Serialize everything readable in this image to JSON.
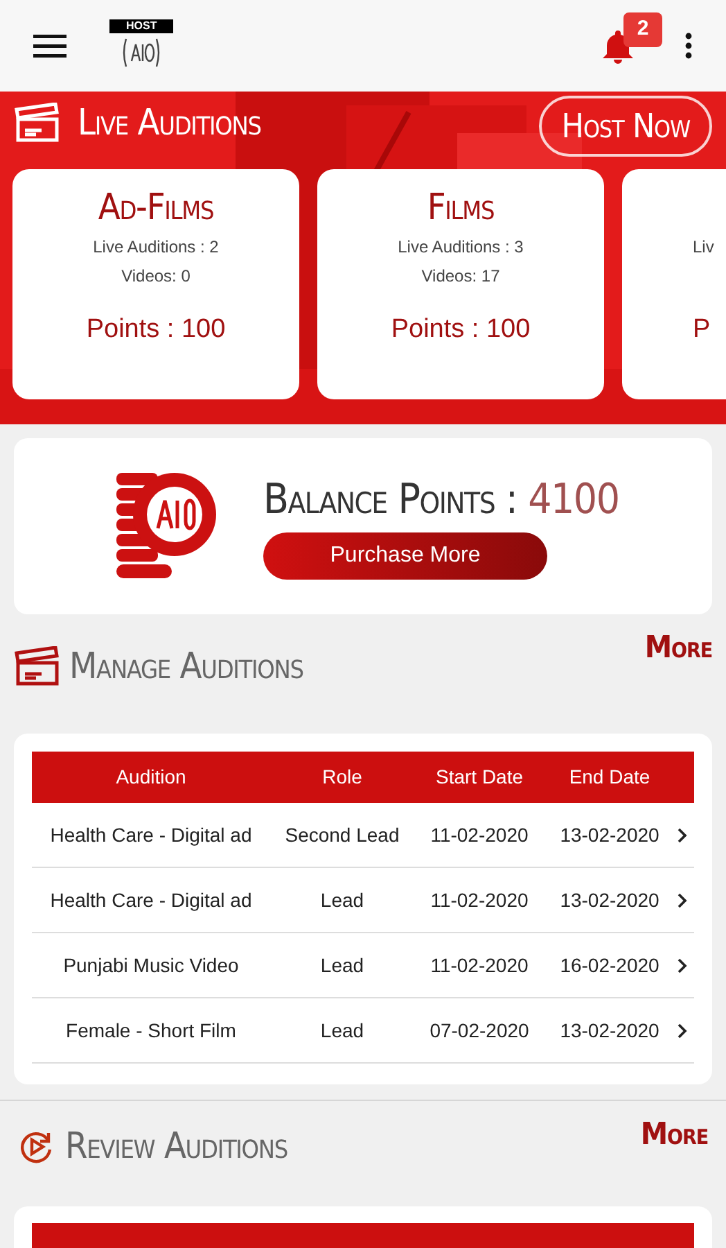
{
  "app_bar": {
    "logo_label": "HOST",
    "notifications": "2"
  },
  "live": {
    "title": "Live Auditions",
    "host_button": "Host Now",
    "cards": [
      {
        "title": "Ad-Films",
        "live": "Live Auditions : 2",
        "videos": "Videos: 0",
        "points": "Points : 100"
      },
      {
        "title": "Films",
        "live": "Live Auditions : 3",
        "videos": "Videos: 17",
        "points": "Points : 100"
      },
      {
        "live": "Liv",
        "points": "P"
      }
    ]
  },
  "balance": {
    "label": "Balance Points :",
    "value": "4100",
    "button": "Purchase More"
  },
  "manage": {
    "title": "Manage Auditions",
    "more": "More",
    "table": {
      "columns": [
        "Audition",
        "Role",
        "Start Date",
        "End Date"
      ],
      "rows": [
        [
          "Health Care - Digital ad",
          "Second Lead",
          "11-02-2020",
          "13-02-2020"
        ],
        [
          "Health Care - Digital ad",
          "Lead",
          "11-02-2020",
          "13-02-2020"
        ],
        [
          "Punjabi Music Video",
          "Lead",
          "11-02-2020",
          "16-02-2020"
        ],
        [
          "Female - Short Film",
          "Lead",
          "07-02-2020",
          "13-02-2020"
        ]
      ]
    }
  },
  "review": {
    "title": "Review Auditions",
    "more": "More"
  }
}
